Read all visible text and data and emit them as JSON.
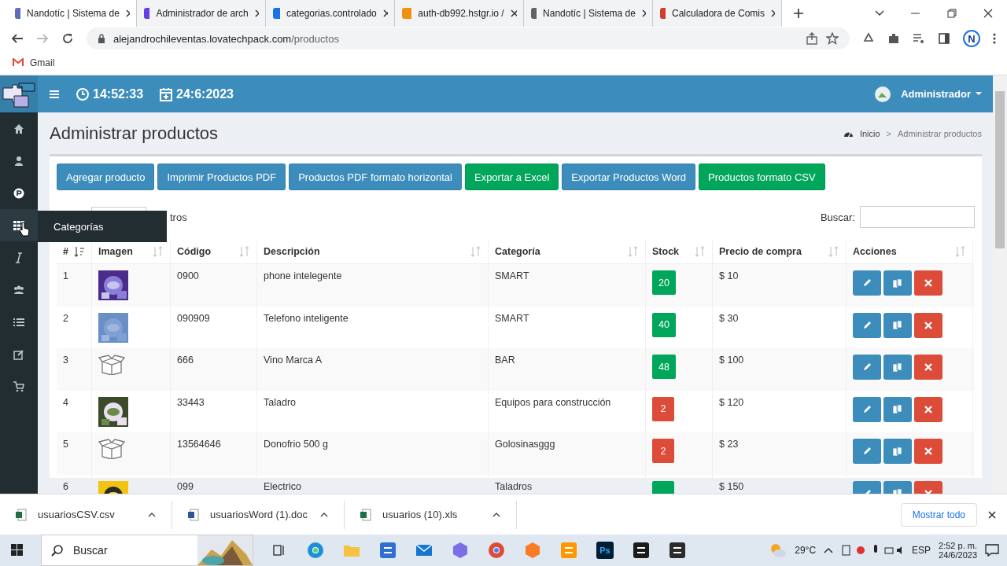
{
  "browser": {
    "tabs": [
      {
        "title": "Nandotíc | Sistema de",
        "kind": "doc",
        "selected": true
      },
      {
        "title": "Administrador de arch",
        "kind": "host",
        "selected": false
      },
      {
        "title": "categorias.controlado",
        "kind": "web",
        "selected": false
      },
      {
        "title": "auth-db992.hstgr.io /",
        "kind": "pma",
        "selected": false
      },
      {
        "title": "Nandotíc | Sistema de",
        "kind": "globe",
        "selected": false
      },
      {
        "title": "Calculadora de Comis",
        "kind": "calc",
        "selected": false
      }
    ],
    "url_host": "alejandrochileventas.lovatechpack.com",
    "url_path": "/productos",
    "profile_initial": "N",
    "bookmarks": [
      "Gmail"
    ]
  },
  "header": {
    "time": "14:52:33",
    "date": "24:6:2023",
    "user": "Administrador"
  },
  "sidebar": {
    "items": [
      {
        "kind": "home",
        "hovered": false
      },
      {
        "kind": "user",
        "hovered": false
      },
      {
        "kind": "p",
        "hovered": false
      },
      {
        "kind": "grid",
        "hovered": true
      },
      {
        "kind": "italic",
        "hovered": false
      },
      {
        "kind": "users",
        "hovered": false
      },
      {
        "kind": "list",
        "hovered": false
      },
      {
        "kind": "edit",
        "hovered": false
      },
      {
        "kind": "cart",
        "hovered": false
      }
    ],
    "tooltip": "Categorías"
  },
  "page": {
    "title": "Administrar productos",
    "breadcrumb": {
      "home": "Inicio",
      "separator": ">",
      "current": "Administrar productos"
    }
  },
  "buttons": [
    {
      "label": "Agregar producto",
      "kind": "primary"
    },
    {
      "label": "Imprimir Productos PDF",
      "kind": "primary"
    },
    {
      "label": "Productos PDF formato horizontal",
      "kind": "primary"
    },
    {
      "label": "Exportar a Excel",
      "kind": "success"
    },
    {
      "label": "Exportar Productos Word",
      "kind": "primary"
    },
    {
      "label": "Productos formato CSV",
      "kind": "success"
    }
  ],
  "length_text": "tros",
  "search": {
    "label": "Buscar:"
  },
  "table": {
    "columns": [
      {
        "label": "#",
        "sorted": true
      },
      {
        "label": "Imagen",
        "sorted": false
      },
      {
        "label": "Código",
        "sorted": false
      },
      {
        "label": "Descripción",
        "sorted": false
      },
      {
        "label": "Categoría",
        "sorted": false
      },
      {
        "label": "Stock",
        "sorted": false
      },
      {
        "label": "Precio de compra",
        "sorted": false
      },
      {
        "label": "Acciones",
        "sorted": false
      }
    ],
    "rows": [
      {
        "n": "1",
        "kind": "picture",
        "code": "0900",
        "description": "phone intelegente",
        "category": "SMART",
        "stock": "20",
        "low": false,
        "price": "$ 10"
      },
      {
        "n": "2",
        "kind": "picture",
        "code": "090909",
        "description": "Telefono inteligente",
        "category": "SMART",
        "stock": "40",
        "low": false,
        "price": "$ 30"
      },
      {
        "n": "3",
        "kind": "placeholder",
        "code": "666",
        "description": "Vino Marca A",
        "category": "BAR",
        "stock": "48",
        "low": false,
        "price": "$ 100"
      },
      {
        "n": "4",
        "kind": "picture",
        "code": "33443",
        "description": "Taladro",
        "category": "Equipos para construcción",
        "stock": "2",
        "low": true,
        "price": "$ 120"
      },
      {
        "n": "5",
        "kind": "placeholder",
        "code": "13564646",
        "description": "Donofrio 500 g",
        "category": "Golosinasggg",
        "stock": "2",
        "low": true,
        "price": "$ 23"
      },
      {
        "n": "6",
        "kind": "picture",
        "code": "099",
        "description": "Electrico",
        "category": "Taladros",
        "low": false,
        "price": "$ 150"
      }
    ]
  },
  "downloads": {
    "items": [
      {
        "name": "usuariosCSV.csv",
        "kind": "sheet"
      },
      {
        "name": "usuariosWord (1).doc",
        "kind": "doc"
      },
      {
        "name": "usuarios (10).xls",
        "kind": "sheet"
      }
    ],
    "show_all": "Mostrar todo"
  },
  "taskbar": {
    "search_placeholder": "Buscar",
    "apps": [
      {
        "kind": "taskview"
      },
      {
        "kind": "edge"
      },
      {
        "kind": "folder"
      },
      {
        "kind": "store"
      },
      {
        "kind": "mail"
      },
      {
        "kind": "hex"
      },
      {
        "kind": "chrome"
      },
      {
        "kind": "xampp"
      },
      {
        "kind": "sublime"
      },
      {
        "kind": "ps",
        "label": "Ps"
      },
      {
        "kind": "recorder"
      },
      {
        "kind": "notes"
      }
    ],
    "weather": "29°C",
    "language": "ESP",
    "time": "2:52 p. m.",
    "date": "24/6/2023"
  }
}
